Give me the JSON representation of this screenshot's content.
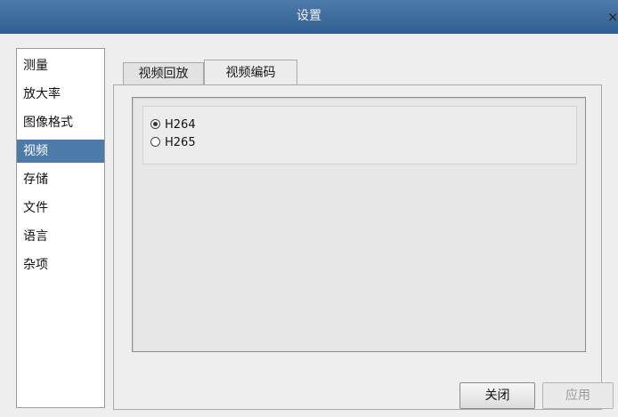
{
  "window": {
    "title": "设置",
    "close_glyph": "×"
  },
  "sidebar": {
    "items": [
      {
        "label": "测量"
      },
      {
        "label": "放大率"
      },
      {
        "label": "图像格式"
      },
      {
        "label": "视频",
        "selected": true
      },
      {
        "label": "存储"
      },
      {
        "label": "文件"
      },
      {
        "label": "语言"
      },
      {
        "label": "杂项"
      }
    ]
  },
  "tabs": [
    {
      "label": "视频回放"
    },
    {
      "label": "视频编码",
      "active": true
    }
  ],
  "encoding": {
    "options": [
      {
        "label": "H264",
        "checked": true
      },
      {
        "label": "H265",
        "checked": false
      }
    ]
  },
  "buttons": {
    "close": "关闭",
    "apply": "应用"
  },
  "colors": {
    "titlebar": "#3a6a9c",
    "selection": "#4c7aa9"
  }
}
